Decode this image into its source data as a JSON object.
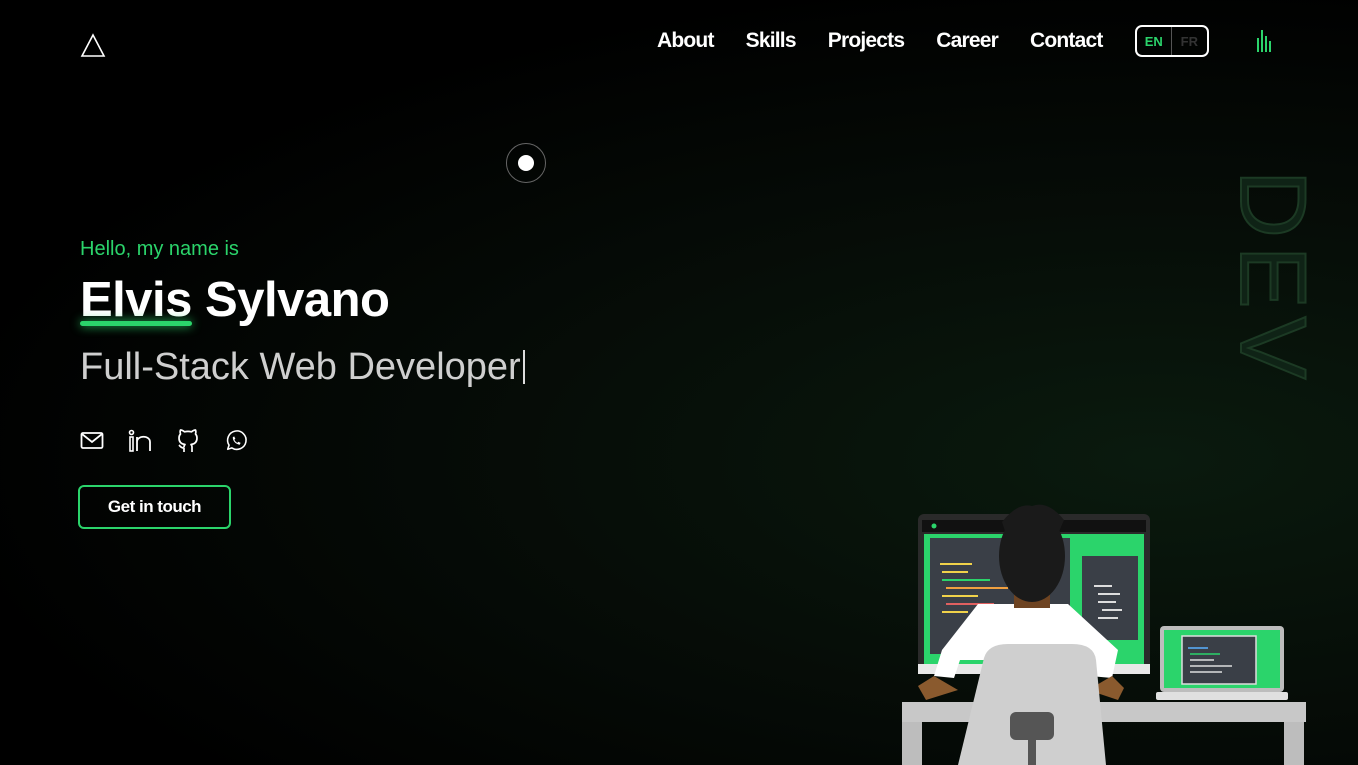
{
  "nav": {
    "links": [
      "About",
      "Skills",
      "Projects",
      "Career",
      "Contact"
    ],
    "lang": {
      "active": "EN",
      "inactive": "FR"
    }
  },
  "hero": {
    "greeting": "Hello, my name is",
    "first_name": "Elvis",
    "last_name": "Sylvano",
    "role": "Full-Stack Web Developer",
    "cta_label": "Get in touch",
    "vertical_word": "DEV"
  },
  "socials": [
    "mail-icon",
    "linkedin-icon",
    "github-icon",
    "whatsapp-icon"
  ],
  "colors": {
    "accent": "#2bd46b",
    "background": "#000000"
  }
}
